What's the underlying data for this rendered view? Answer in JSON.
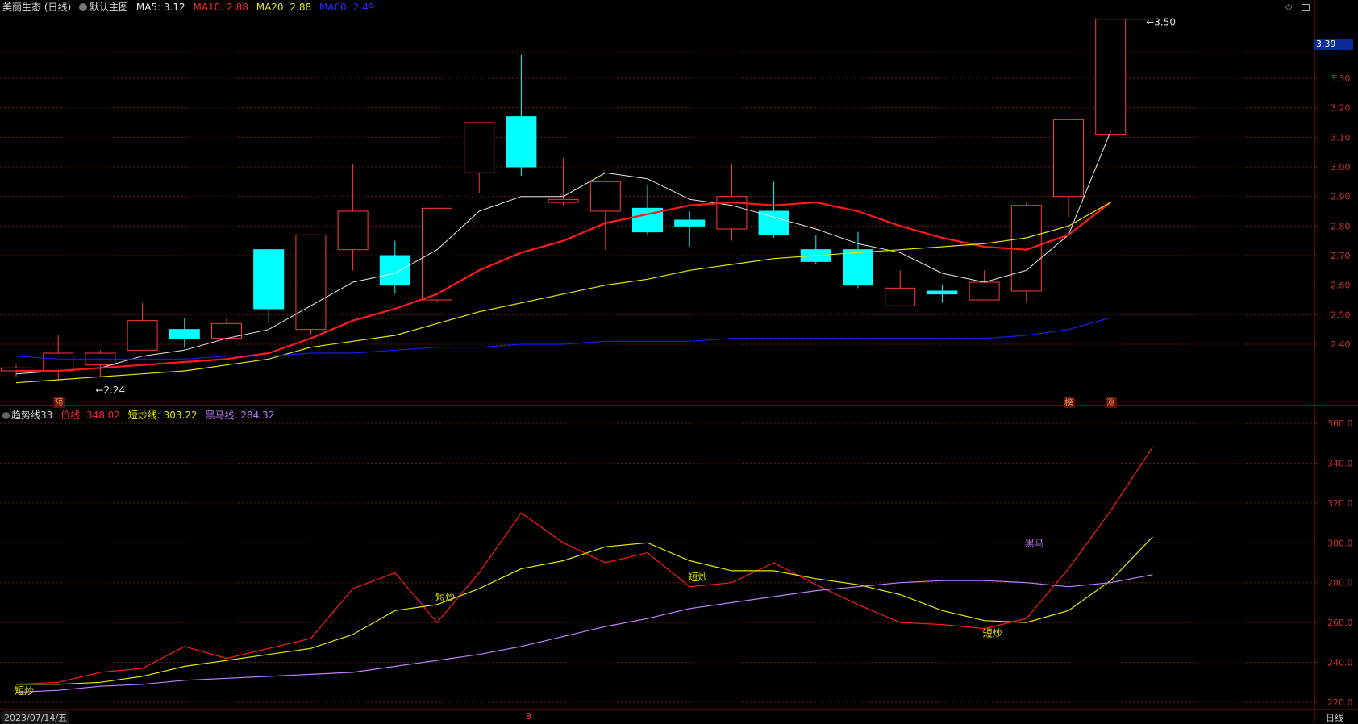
{
  "header": {
    "stock_label": "美丽生态 (日线)",
    "chart_mode": "默认主图",
    "ma5": "MA5: 3.12",
    "ma10": "MA10: 2.88",
    "ma20": "MA20: 2.88",
    "ma60": "MA60: 2.49"
  },
  "indicator_header": {
    "name": "趋势线33",
    "price_line": "价线: 348.02",
    "short_line": "短炒线: 303.22",
    "horse_line": "黑马线: 284.32"
  },
  "bottom": {
    "date": "2023/07/14/五",
    "month_mark": "8",
    "period": "日线"
  },
  "colors": {
    "up": "#ff3b3b",
    "down": "#00ffff",
    "ma5": "#e8e8e8",
    "ma10": "#ff1a1a",
    "ma20": "#e6e600",
    "ma60": "#1a1aff",
    "price_line": "#ff1a1a",
    "short_line": "#e6e600",
    "horse_line": "#c080ff",
    "grid": "#7a1010"
  },
  "icons": [
    "diamond-icon",
    "restore-icon"
  ],
  "chart_data": [
    {
      "type": "candlestick",
      "ylim": [
        2.3,
        3.5
      ],
      "yticks": [
        "2.40",
        "2.50",
        "2.60",
        "2.70",
        "2.80",
        "2.90",
        "3.00",
        "3.10",
        "3.20",
        "3.30"
      ],
      "current_price": "3.39",
      "high_label": "3.50",
      "low_label": "2.24",
      "candles": [
        {
          "o": 2.31,
          "h": 2.33,
          "l": 2.29,
          "c": 2.32
        },
        {
          "o": 2.31,
          "h": 2.43,
          "l": 2.28,
          "c": 2.37
        },
        {
          "o": 2.33,
          "h": 2.38,
          "l": 2.29,
          "c": 2.37
        },
        {
          "o": 2.38,
          "h": 2.54,
          "l": 2.38,
          "c": 2.48
        },
        {
          "o": 2.45,
          "h": 2.49,
          "l": 2.39,
          "c": 2.42
        },
        {
          "o": 2.42,
          "h": 2.49,
          "l": 2.41,
          "c": 2.47
        },
        {
          "o": 2.72,
          "h": 2.72,
          "l": 2.47,
          "c": 2.52
        },
        {
          "o": 2.45,
          "h": 2.77,
          "l": 2.43,
          "c": 2.77
        },
        {
          "o": 2.72,
          "h": 3.01,
          "l": 2.65,
          "c": 2.85
        },
        {
          "o": 2.7,
          "h": 2.75,
          "l": 2.57,
          "c": 2.6
        },
        {
          "o": 2.55,
          "h": 2.86,
          "l": 2.54,
          "c": 2.86
        },
        {
          "o": 2.98,
          "h": 3.15,
          "l": 2.91,
          "c": 3.15
        },
        {
          "o": 3.17,
          "h": 3.38,
          "l": 2.97,
          "c": 3.0
        },
        {
          "o": 2.88,
          "h": 3.03,
          "l": 2.87,
          "c": 2.89
        },
        {
          "o": 2.85,
          "h": 2.95,
          "l": 2.72,
          "c": 2.95
        },
        {
          "o": 2.86,
          "h": 2.94,
          "l": 2.77,
          "c": 2.78
        },
        {
          "o": 2.82,
          "h": 2.85,
          "l": 2.73,
          "c": 2.8
        },
        {
          "o": 2.79,
          "h": 3.01,
          "l": 2.75,
          "c": 2.9
        },
        {
          "o": 2.85,
          "h": 2.95,
          "l": 2.76,
          "c": 2.77
        },
        {
          "o": 2.72,
          "h": 2.77,
          "l": 2.67,
          "c": 2.68
        },
        {
          "o": 2.72,
          "h": 2.78,
          "l": 2.59,
          "c": 2.6
        },
        {
          "o": 2.53,
          "h": 2.65,
          "l": 2.53,
          "c": 2.59
        },
        {
          "o": 2.58,
          "h": 2.6,
          "l": 2.54,
          "c": 2.57
        },
        {
          "o": 2.55,
          "h": 2.65,
          "l": 2.55,
          "c": 2.61
        },
        {
          "o": 2.58,
          "h": 2.88,
          "l": 2.54,
          "c": 2.87
        },
        {
          "o": 2.9,
          "h": 3.16,
          "l": 2.83,
          "c": 3.16
        },
        {
          "o": 3.11,
          "h": 3.5,
          "l": 3.11,
          "c": 3.5
        }
      ],
      "series": [
        {
          "name": "MA5",
          "values": [
            2.3,
            2.31,
            2.32,
            2.36,
            2.38,
            2.42,
            2.45,
            2.53,
            2.61,
            2.64,
            2.72,
            2.85,
            2.9,
            2.9,
            2.98,
            2.96,
            2.89,
            2.87,
            2.83,
            2.79,
            2.74,
            2.71,
            2.64,
            2.61,
            2.65,
            2.77,
            3.12
          ]
        },
        {
          "name": "MA10",
          "values": [
            2.31,
            2.31,
            2.32,
            2.33,
            2.34,
            2.35,
            2.37,
            2.42,
            2.48,
            2.52,
            2.57,
            2.65,
            2.71,
            2.75,
            2.81,
            2.84,
            2.87,
            2.88,
            2.87,
            2.88,
            2.85,
            2.8,
            2.76,
            2.73,
            2.72,
            2.77,
            2.88
          ]
        },
        {
          "name": "MA20",
          "values": [
            2.27,
            2.28,
            2.29,
            2.3,
            2.31,
            2.33,
            2.35,
            2.39,
            2.41,
            2.43,
            2.47,
            2.51,
            2.54,
            2.57,
            2.6,
            2.62,
            2.65,
            2.67,
            2.69,
            2.7,
            2.71,
            2.72,
            2.73,
            2.74,
            2.76,
            2.8,
            2.88
          ]
        },
        {
          "name": "MA60",
          "values": [
            2.36,
            2.35,
            2.35,
            2.35,
            2.35,
            2.36,
            2.36,
            2.37,
            2.37,
            2.38,
            2.39,
            2.39,
            2.4,
            2.4,
            2.41,
            2.41,
            2.41,
            2.42,
            2.42,
            2.42,
            2.42,
            2.42,
            2.42,
            2.42,
            2.43,
            2.45,
            2.49
          ]
        }
      ],
      "markers": [
        {
          "index": 1,
          "label": "预"
        },
        {
          "index": 25,
          "label": "榜"
        },
        {
          "index": 26,
          "label": "涨"
        }
      ]
    },
    {
      "type": "line",
      "title": "趋势线33",
      "ylim": [
        217,
        365
      ],
      "yticks": [
        "220.0",
        "240.0",
        "260.0",
        "280.0",
        "300.0",
        "320.0",
        "340.0",
        "360.0"
      ],
      "series": [
        {
          "name": "价线",
          "values": [
            229,
            230,
            235,
            237,
            248,
            242,
            247,
            252,
            277,
            285,
            260,
            285,
            315,
            300,
            290,
            295,
            278,
            280,
            290,
            279,
            269,
            260,
            259,
            257,
            262,
            287,
            316,
            348
          ]
        },
        {
          "name": "短炒线",
          "values": [
            229,
            229,
            230,
            233,
            238,
            241,
            244,
            247,
            254,
            266,
            269,
            277,
            287,
            291,
            298,
            300,
            291,
            286,
            286,
            282,
            279,
            274,
            266,
            261,
            260,
            266,
            281,
            303
          ]
        },
        {
          "name": "黑马线",
          "values": [
            225,
            226,
            228,
            229,
            231,
            232,
            233,
            234,
            235,
            238,
            241,
            244,
            248,
            253,
            258,
            262,
            267,
            270,
            273,
            276,
            278,
            280,
            281,
            281,
            280,
            278,
            280,
            284
          ]
        }
      ],
      "annotations": [
        {
          "index": 0,
          "label": "短炒",
          "y": 224
        },
        {
          "index": 10,
          "label": "短炒",
          "y": 271
        },
        {
          "index": 16,
          "label": "短炒",
          "y": 281
        },
        {
          "index": 23,
          "label": "短炒",
          "y": 253
        },
        {
          "index": 24,
          "label": "黑马",
          "y": 298
        }
      ]
    }
  ]
}
